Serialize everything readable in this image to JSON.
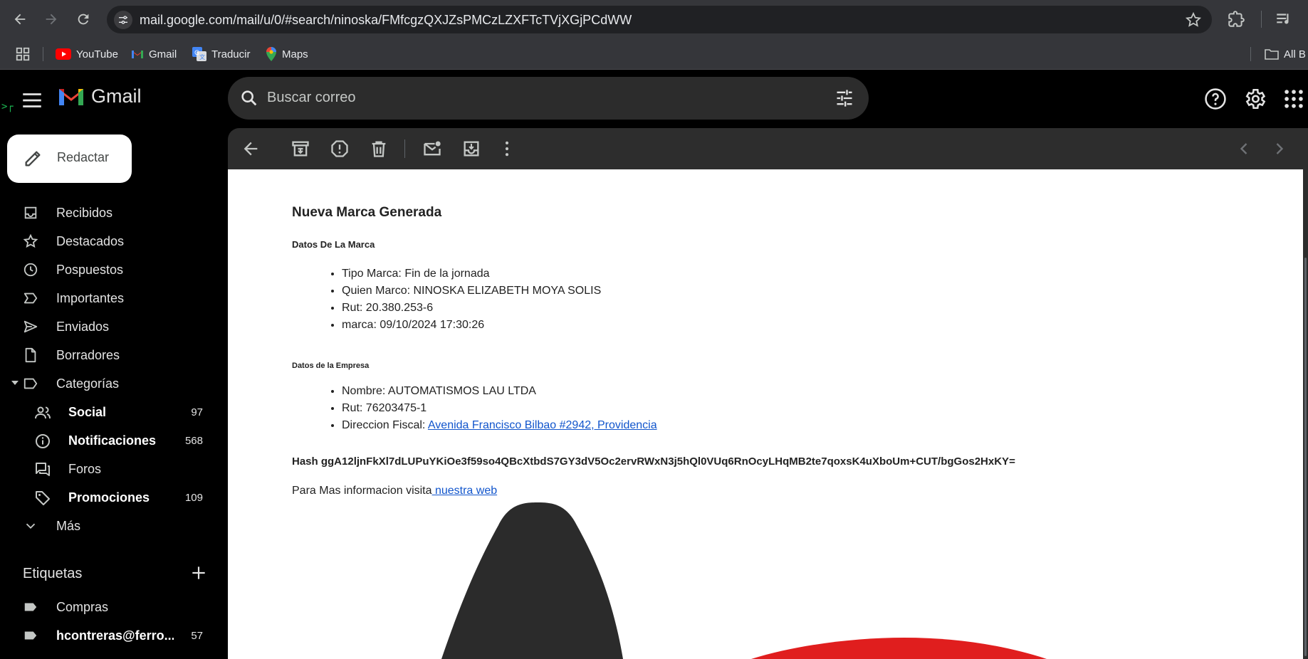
{
  "browser": {
    "url": "mail.google.com/mail/u/0/#search/ninoska/FMfcgzQXJZsPMCzLZXFTcTVjXGjPCdWW",
    "bookmarks": [
      {
        "label": "YouTube",
        "icon": "youtube-icon"
      },
      {
        "label": "Gmail",
        "icon": "gmail-icon"
      },
      {
        "label": "Traducir",
        "icon": "translate-icon"
      },
      {
        "label": "Maps",
        "icon": "maps-icon"
      }
    ],
    "all_bookmarks_label": "All B"
  },
  "gmail": {
    "app_name": "Gmail",
    "search_placeholder": "Buscar correo",
    "compose_label": "Redactar",
    "nav": [
      {
        "label": "Recibidos",
        "icon": "inbox-icon"
      },
      {
        "label": "Destacados",
        "icon": "star-icon"
      },
      {
        "label": "Pospuestos",
        "icon": "clock-icon"
      },
      {
        "label": "Importantes",
        "icon": "label-important-icon"
      },
      {
        "label": "Enviados",
        "icon": "send-icon"
      },
      {
        "label": "Borradores",
        "icon": "draft-icon"
      },
      {
        "label": "Categorías",
        "icon": "label-icon"
      }
    ],
    "categories": [
      {
        "label": "Social",
        "count": "97",
        "icon": "people-icon"
      },
      {
        "label": "Notificaciones",
        "count": "568",
        "icon": "info-icon"
      },
      {
        "label": "Foros",
        "count": "",
        "icon": "forum-icon"
      },
      {
        "label": "Promociones",
        "count": "109",
        "icon": "tag-icon"
      }
    ],
    "more_label": "Más",
    "labels_title": "Etiquetas",
    "labels": [
      {
        "label": "Compras",
        "count": ""
      },
      {
        "label": "hcontreras@ferro...",
        "count": "57"
      }
    ]
  },
  "message": {
    "title": "Nueva Marca Generada",
    "section1_title": "Datos De La Marca",
    "section1_items": [
      "Tipo Marca: Fin de la jornada",
      "Quien Marco: NINOSKA ELIZABETH MOYA SOLIS",
      "Rut: 20.380.253-6",
      "marca: 09/10/2024 17:30:26"
    ],
    "section2_title": "Datos de la Empresa",
    "section2_items": [
      "Nombre: AUTOMATISMOS LAU LTDA",
      "Rut: 76203475-1"
    ],
    "address_prefix": "Direccion Fiscal: ",
    "address_link": "Avenida Francisco Bilbao #2942, Providencia",
    "hash": "Hash ggA12ljnFkXl7dLUPuYKiOe3f59so4QBcXtbdS7GY3dV5Oc2ervRWxN3j5hQl0VUq6RnOcyLHqMB2te7qoxsK4uXboUm+CUT/bgGos2HxKY=",
    "more_info_text": "Para Mas informacion visita",
    "more_info_link": " nuestra web"
  }
}
